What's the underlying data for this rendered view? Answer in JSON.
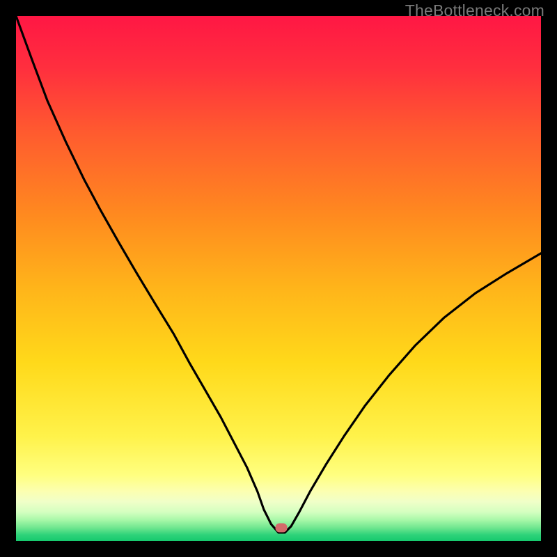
{
  "watermark": "TheBottleneck.com",
  "marker": {
    "x_frac": 0.505,
    "y_frac": 0.975,
    "color": "#d46a6a"
  },
  "gradient": {
    "stops": [
      {
        "offset": 0.0,
        "color": "#ff1744"
      },
      {
        "offset": 0.1,
        "color": "#ff2f3e"
      },
      {
        "offset": 0.22,
        "color": "#ff5a2f"
      },
      {
        "offset": 0.38,
        "color": "#ff8a1f"
      },
      {
        "offset": 0.52,
        "color": "#ffb51a"
      },
      {
        "offset": 0.66,
        "color": "#ffd91a"
      },
      {
        "offset": 0.8,
        "color": "#fff24a"
      },
      {
        "offset": 0.875,
        "color": "#ffff80"
      },
      {
        "offset": 0.905,
        "color": "#fcffb0"
      },
      {
        "offset": 0.925,
        "color": "#f0ffc8"
      },
      {
        "offset": 0.945,
        "color": "#d4ffc0"
      },
      {
        "offset": 0.96,
        "color": "#a8f8a8"
      },
      {
        "offset": 0.975,
        "color": "#6fe68f"
      },
      {
        "offset": 0.988,
        "color": "#2fd37a"
      },
      {
        "offset": 1.0,
        "color": "#16c96e"
      }
    ]
  },
  "chart_data": {
    "type": "line",
    "title": "",
    "xlabel": "",
    "ylabel": "",
    "xlim": [
      0,
      1
    ],
    "ylim": [
      0,
      1
    ],
    "series": [
      {
        "name": "bottleneck-curve",
        "x": [
          0.0,
          0.03,
          0.06,
          0.095,
          0.13,
          0.16,
          0.195,
          0.23,
          0.265,
          0.3,
          0.33,
          0.36,
          0.39,
          0.415,
          0.44,
          0.46,
          0.472,
          0.486,
          0.5,
          0.512,
          0.524,
          0.54,
          0.56,
          0.59,
          0.625,
          0.665,
          0.71,
          0.76,
          0.815,
          0.875,
          0.935,
          1.0
        ],
        "y": [
          1.0,
          0.918,
          0.838,
          0.76,
          0.688,
          0.632,
          0.57,
          0.51,
          0.452,
          0.395,
          0.34,
          0.288,
          0.236,
          0.188,
          0.14,
          0.094,
          0.06,
          0.032,
          0.016,
          0.016,
          0.028,
          0.056,
          0.094,
          0.145,
          0.2,
          0.258,
          0.315,
          0.372,
          0.425,
          0.472,
          0.51,
          0.548
        ]
      }
    ],
    "annotations": [
      {
        "text": "TheBottleneck.com",
        "role": "watermark",
        "position": "top-right"
      }
    ]
  }
}
